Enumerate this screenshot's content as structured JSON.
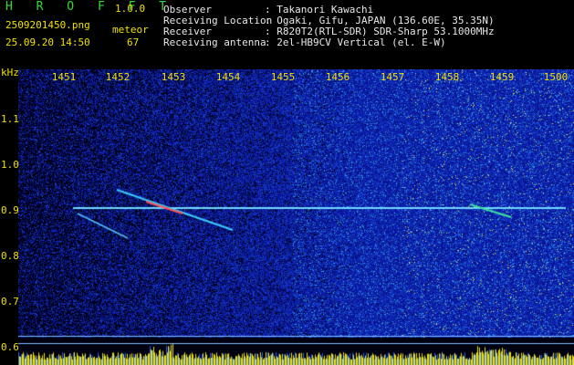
{
  "header": {
    "app_name": "H R O F F T",
    "version": "1.0.0",
    "filename": "2509201450.png",
    "datetime": "25.09.20 14:50",
    "meteor_label": "meteor",
    "meteor_count": "67",
    "observer_label": "Observer",
    "observer_value": ": Takanori Kawachi",
    "location_label": "Receiving Location",
    "location_value": ": Ogaki, Gifu, JAPAN (136.60E, 35.35N)",
    "receiver_label": "Receiver",
    "receiver_value": ": R820T2(RTL-SDR) SDR-Sharp 53.1000MHz",
    "antenna_label": "Receiving antenna",
    "antenna_value": ": 2el-HB9CV Vertical (el. E-W)"
  },
  "axes": {
    "y_unit": "kHz",
    "x_ticks": [
      "1451",
      "1452",
      "1453",
      "1454",
      "1455",
      "1456",
      "1457",
      "1458",
      "1459",
      "1500"
    ],
    "y_ticks": [
      "1.1",
      "1.0",
      "0.9",
      "0.8",
      "0.7",
      "0.6"
    ]
  },
  "colors": {
    "background": "#000000",
    "label_yellow": "#f0e000",
    "title_green": "#33dd33",
    "noise_blue": "#1020a0",
    "signal_cyan": "#60e0ff"
  }
}
